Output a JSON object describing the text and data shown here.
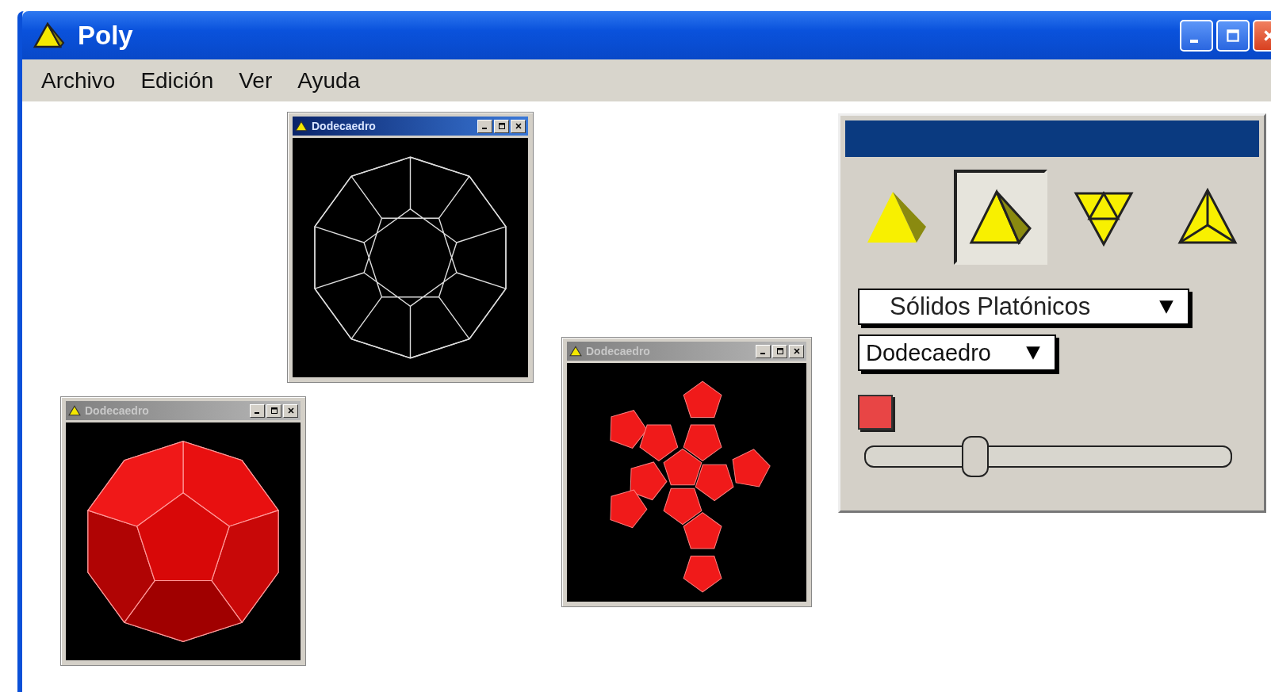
{
  "window": {
    "title": "Poly"
  },
  "menu": [
    "Archivo",
    "Edición",
    "Ver",
    "Ayuda"
  ],
  "documents": [
    {
      "title": "Dodecaedro",
      "active": true,
      "kind": "wireframe"
    },
    {
      "title": "Dodecaedro",
      "active": false,
      "kind": "solid"
    },
    {
      "title": "Dodecaedro",
      "active": false,
      "kind": "net"
    }
  ],
  "control_panel": {
    "view_modes": [
      {
        "kind": "shaded",
        "selected": false
      },
      {
        "kind": "outlined",
        "selected": true
      },
      {
        "kind": "net",
        "selected": false
      },
      {
        "kind": "vertex",
        "selected": false
      }
    ],
    "family": "Sólidos Platónicos",
    "polyhedron": "Dodecaedro",
    "color": "#e84545",
    "slider": {
      "level": 0.3
    }
  }
}
